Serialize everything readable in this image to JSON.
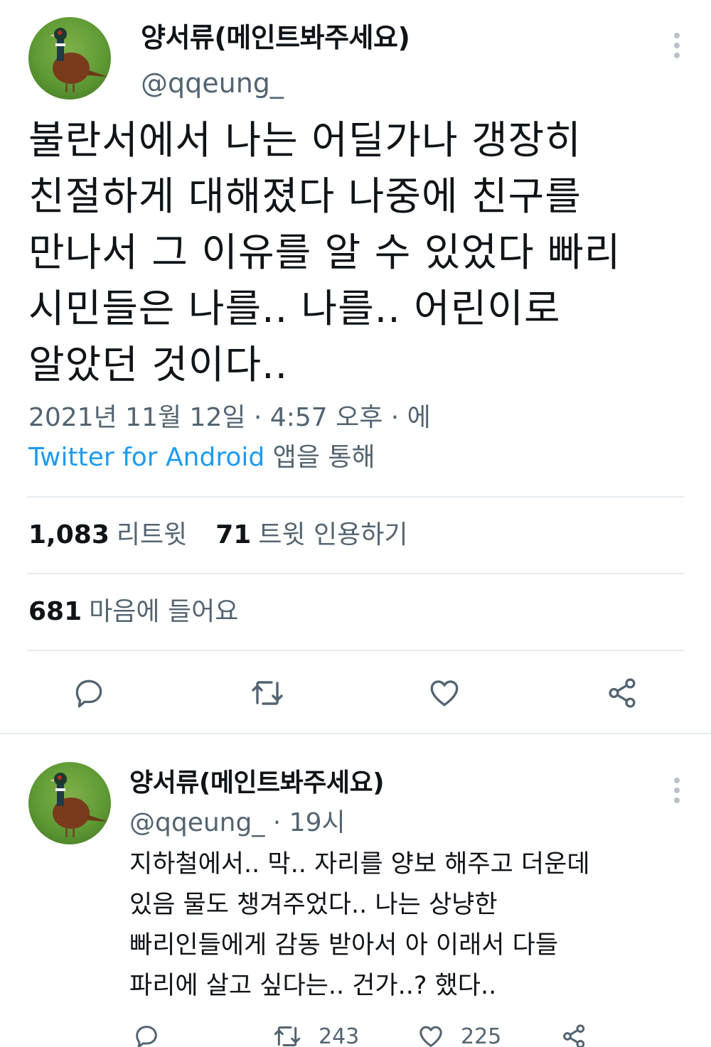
{
  "main_tweet": {
    "display_name": "양서류(메인트봐주세요)",
    "handle": "@qqeung_",
    "text": "불란서에서 나는 어딜가나 갱장히\n친절하게 대해졌다 나중에 친구를\n만나서 그 이유를 알 수 있었다 빠리\n시민들은 나를.. 나를.. 어린이로\n알았던 것이다..",
    "timestamp": "2021년 11월 12일 · 4:57 오후 · 에",
    "source": "Twitter for Android",
    "source_suffix": " 앱을 통해",
    "retweets_count": "1,083",
    "retweets_label": "리트윗",
    "quotes_count": "71",
    "quotes_label": "트윗 인용하기",
    "likes_count": "681",
    "likes_label": "마음에 들어요",
    "avatar_icon": "pheasant-avatar",
    "more_icon": "more-vertical-icon"
  },
  "reply_tweet": {
    "display_name": "양서류(메인트봐주세요)",
    "handle": "@qqeung_",
    "time_ago": " · 19시",
    "text": "지하철에서.. 막.. 자리를 양보 해주고 더운데\n있음 물도 챙겨주었다.. 나는 상냥한\n빠리인들에게 감동 받아서 아 이래서 다들\n파리에 살고 싶다는.. 건가..? 했다..",
    "retweet_count": "243",
    "like_count": "225"
  },
  "colors": {
    "text": "#0f1419",
    "secondary": "#536471",
    "link": "#1d9bf0",
    "divider": "#e6ecf0"
  }
}
